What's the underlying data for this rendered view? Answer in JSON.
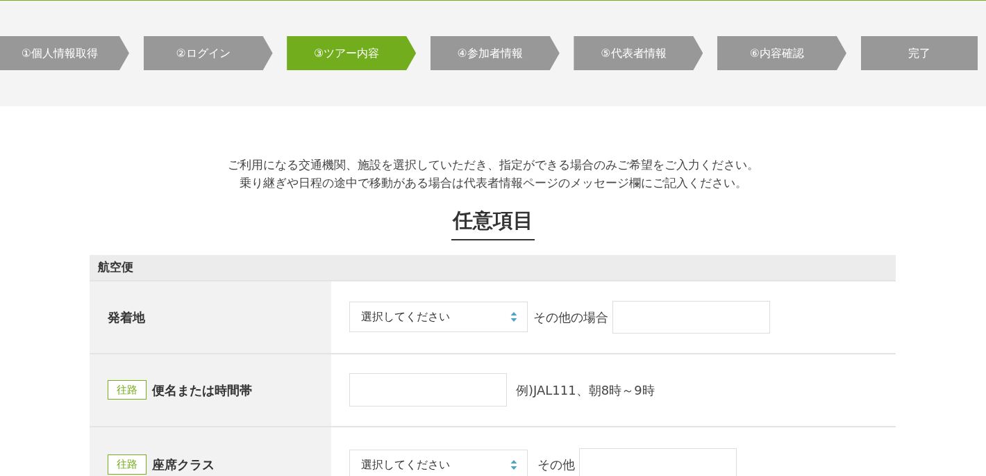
{
  "steps": [
    {
      "label": "①個人情報取得",
      "selected": false
    },
    {
      "label": "②ログイン",
      "selected": false
    },
    {
      "label": "③ツアー内容",
      "selected": true
    },
    {
      "label": "④参加者情報",
      "selected": false
    },
    {
      "label": "⑤代表者情報",
      "selected": false
    },
    {
      "label": "⑥内容確認",
      "selected": false
    },
    {
      "label": "完了",
      "selected": false
    }
  ],
  "intro": [
    "ご利用になる交通機関、施設を選択していただき、指定ができる場合のみご希望をご入力ください。",
    "乗り継ぎや日程の途中で移動がある場合は代表者情報ページのメッセージ欄にご記入ください。"
  ],
  "heading": "任意項目",
  "section": {
    "title": "航空便",
    "rows": [
      {
        "kind": "select",
        "label": "発着地",
        "select": "選択してください",
        "other_label": "その他の場合"
      },
      {
        "kind": "input",
        "tag": "往路",
        "label": "便名または時間帯",
        "example": "例)JAL111、朝8時～9時"
      },
      {
        "kind": "select",
        "tag": "往路",
        "label": "座席クラス",
        "select": "選択してください",
        "other_label": "その他"
      }
    ]
  }
}
